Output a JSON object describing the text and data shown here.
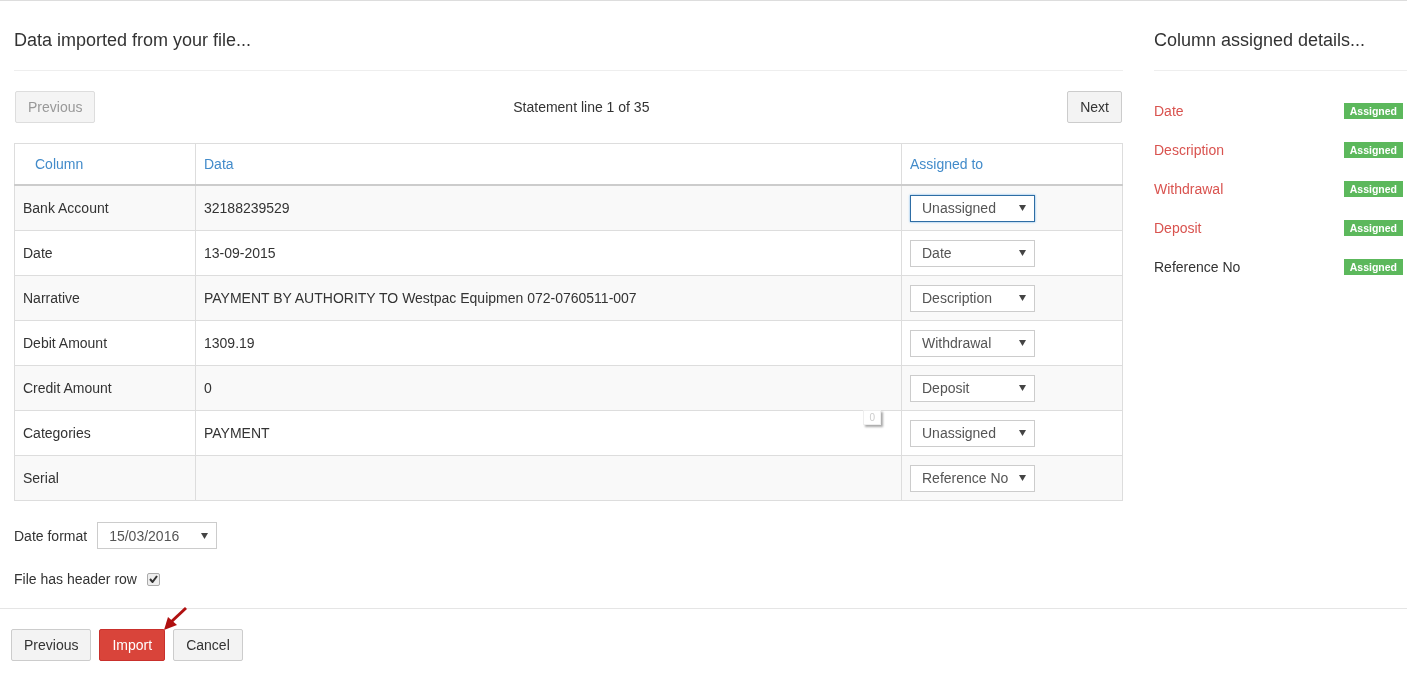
{
  "main_title": "Data imported from your file...",
  "pager": {
    "previous": {
      "label": "Previous",
      "disabled": true
    },
    "status": "Statement line 1 of 35",
    "next": {
      "label": "Next",
      "disabled": false
    }
  },
  "table": {
    "columns": [
      "Column",
      "Data",
      "Assigned to"
    ],
    "rows": [
      {
        "column": "Bank Account",
        "data": "32188239529",
        "assigned_to": "Unassigned",
        "focused": true
      },
      {
        "column": "Date",
        "data": "13-09-2015",
        "assigned_to": "Date",
        "focused": false
      },
      {
        "column": "Narrative",
        "data": "PAYMENT BY AUTHORITY TO Westpac Equipmen 072-0760511-007",
        "assigned_to": "Description",
        "focused": false
      },
      {
        "column": "Debit Amount",
        "data": "1309.19",
        "assigned_to": "Withdrawal",
        "focused": false
      },
      {
        "column": "Credit Amount",
        "data": "0",
        "assigned_to": "Deposit",
        "focused": false
      },
      {
        "column": "Categories",
        "data": "PAYMENT",
        "assigned_to": "Unassigned",
        "focused": false,
        "marker": "0"
      },
      {
        "column": "Serial",
        "assigned_to": "Reference No",
        "focused": false
      }
    ]
  },
  "date_format": {
    "label": "Date format",
    "value": "15/03/2016"
  },
  "header_row": {
    "label": "File has header row",
    "checked": true
  },
  "buttons": [
    {
      "label": "Previous",
      "kind": "default"
    },
    {
      "label": "Import",
      "kind": "danger"
    },
    {
      "label": "Cancel",
      "kind": "default"
    }
  ],
  "side": {
    "title": "Column assigned details...",
    "items": [
      {
        "name": "Date",
        "color": "#d9534f",
        "badge": "Assigned"
      },
      {
        "name": "Description",
        "color": "#d9534f",
        "badge": "Assigned"
      },
      {
        "name": "Withdrawal",
        "color": "#d9534f",
        "badge": "Assigned"
      },
      {
        "name": "Deposit",
        "color": "#d9534f",
        "badge": "Assigned"
      },
      {
        "name": "Reference No",
        "color": "#333333",
        "badge": "Assigned"
      }
    ]
  }
}
